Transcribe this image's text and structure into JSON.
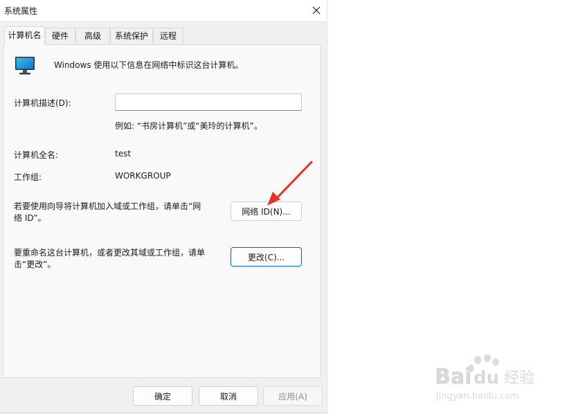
{
  "window": {
    "title": "系统属性",
    "close_icon": "close-icon"
  },
  "tabs": [
    {
      "label": "计算机名",
      "active": true
    },
    {
      "label": "硬件",
      "active": false
    },
    {
      "label": "高级",
      "active": false
    },
    {
      "label": "系统保护",
      "active": false
    },
    {
      "label": "远程",
      "active": false
    }
  ],
  "panel": {
    "intro": "Windows 使用以下信息在网络中标识这台计算机。",
    "monitor_icon": "computer-monitor-icon",
    "description_label": "计算机描述(D):",
    "description_value": "",
    "description_example": "例如: “书房计算机”或“美玲的计算机”。",
    "full_name_label": "计算机全名:",
    "full_name_value": "test",
    "workgroup_label": "工作组:",
    "workgroup_value": "WORKGROUP",
    "network_id_text": "若要使用向导将计算机加入域或工作组，请单击“网络 ID”。",
    "network_id_button": "网络 ID(N)...",
    "rename_text": "要重命名这台计算机，或者更改其域或工作组，请单击“更改”。",
    "change_button": "更改(C)..."
  },
  "footer": {
    "ok_button": "确定",
    "cancel_button": "取消",
    "apply_button": "应用(A)"
  },
  "annotation": {
    "arrow_color": "#e8302a"
  },
  "watermark": {
    "brand": "Baidu经验",
    "url": "jingyan.baidu.com"
  },
  "colors": {
    "accent": "#0067c0",
    "dialog_bg": "#f0f0f0",
    "panel_bg": "#f9f9f9"
  }
}
